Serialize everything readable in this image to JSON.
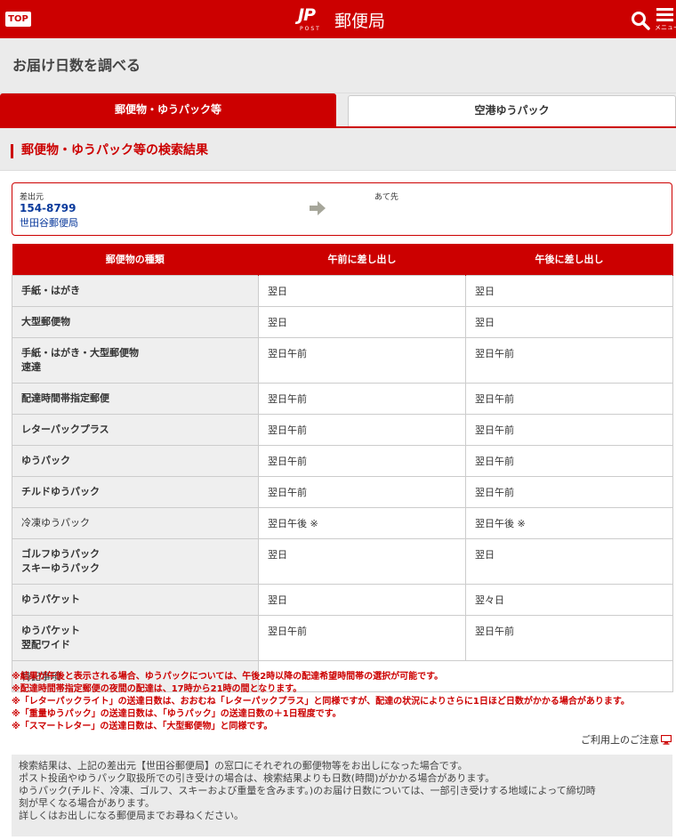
{
  "header": {
    "top_label": "TOP",
    "logo_mark": "JP",
    "logo_post": "POST",
    "brand": "郵便局",
    "menu_label": "メニュー",
    "accent": "#cc0000"
  },
  "page": {
    "title": "お届け日数を調べる"
  },
  "tabs": [
    {
      "label": "郵便物・ゆうパック等",
      "active": true
    },
    {
      "label": "空港ゆうパック",
      "active": false
    }
  ],
  "section": {
    "heading": "郵便物・ゆうパック等の検索結果"
  },
  "route": {
    "from_label": "差出元",
    "zip": "154-8799",
    "office": "世田谷郵便局",
    "to_label": "あて先"
  },
  "table": {
    "headers": [
      "郵便物の種類",
      "午前に差し出し",
      "午後に差し出し"
    ],
    "rows": [
      {
        "kind": [
          "手紙・はがき"
        ],
        "am": "翌日",
        "pm": "翌日"
      },
      {
        "kind": [
          "大型郵便物"
        ],
        "am": "翌日",
        "pm": "翌日"
      },
      {
        "kind": [
          "手紙・はがき・大型郵便物",
          "速達"
        ],
        "am": "翌日午前",
        "pm": "翌日午前"
      },
      {
        "kind": [
          "配達時間帯指定郵便"
        ],
        "am": "翌日午前",
        "pm": "翌日午前"
      },
      {
        "kind": [
          "レターパックプラス"
        ],
        "am": "翌日午前",
        "pm": "翌日午前"
      },
      {
        "kind": [
          "ゆうパック"
        ],
        "am": "翌日午前",
        "pm": "翌日午前"
      },
      {
        "kind": [
          "チルドゆうパック"
        ],
        "am": "翌日午前",
        "pm": "翌日午前"
      },
      {
        "kind": [
          "冷凍ゆうパック"
        ],
        "am": "翌日午後 ※",
        "pm": "翌日午後 ※",
        "light": true
      },
      {
        "kind": [
          "ゴルフゆうパック",
          "スキーゆうパック"
        ],
        "am": "翌日",
        "pm": "翌日"
      },
      {
        "kind": [
          "ゆうパケット"
        ],
        "am": "翌日",
        "pm": "翌々日"
      },
      {
        "kind": [
          "ゆうパケット",
          "翌配ワイド"
        ],
        "am": "翌日午前",
        "pm": "翌日午前"
      }
    ],
    "special_label": "特記事項",
    "special_value": ""
  },
  "notes": [
    "※結果が午後と表示される場合、ゆうパックについては、午後2時以降の配達希望時間帯の選択が可能です。",
    "※配達時間帯指定郵便の夜間の配達は、17時から21時の間となります。",
    "※「レターパックライト」の送達日数は、おおむね「レターパックプラス」と同様ですが、配達の状況によりさらに1日ほど日数がかかる場合があります。",
    "※「重量ゆうパック」の送達日数は、「ゆうパック」の送達日数の＋1日程度です。",
    "※「スマートレター」の送達日数は、「大型郵便物」と同様です。"
  ],
  "caution_link": "ご利用上のご注意",
  "info": [
    "検索結果は、上記の差出元【世田谷郵便局】の窓口にそれぞれの郵便物等をお出しになった場合です。",
    "ポスト投函やゆうパック取扱所での引き受けの場合は、検索結果よりも日数(時間)がかかる場合があります。",
    "ゆうパック(チルド、冷凍、ゴルフ、スキーおよび重量を含みます。)のお届け日数については、一部引き受けする地域によって締切時",
    "刻が早くなる場合があります。",
    "詳しくはお出しになる郵便局までお尋ねください。"
  ]
}
